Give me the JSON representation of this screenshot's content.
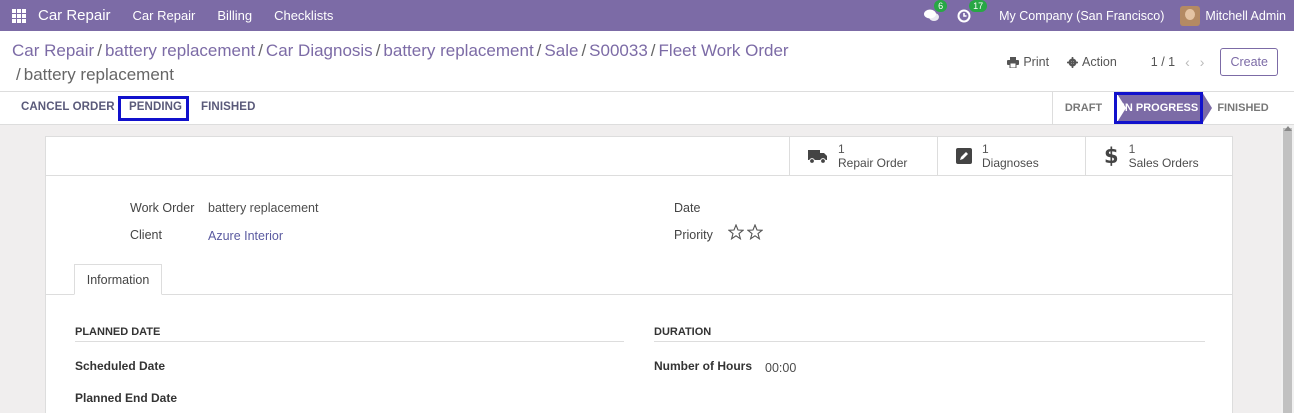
{
  "navbar": {
    "app_name": "Car Repair",
    "menus": [
      "Car Repair",
      "Billing",
      "Checklists"
    ],
    "messages_count": "6",
    "activities_count": "17",
    "company": "My Company (San Francisco)",
    "user": "Mitchell Admin"
  },
  "breadcrumb": {
    "items": [
      "Car Repair",
      "battery replacement",
      "Car Diagnosis",
      "battery replacement",
      "Sale",
      "S00033",
      "Fleet Work Order"
    ],
    "current": "battery replacement",
    "separator": "/"
  },
  "control": {
    "print_label": "Print",
    "action_label": "Action",
    "pager": "1 / 1",
    "create_label": "Create"
  },
  "statusbar": {
    "buttons": [
      "CANCEL ORDER",
      "PENDING",
      "FINISHED"
    ],
    "stages": [
      "DRAFT",
      "IN PROGRESS",
      "FINISHED"
    ],
    "active_stage": "IN PROGRESS",
    "highlight_color": "#1111cc"
  },
  "smart_buttons": [
    {
      "count": "1",
      "label": "Repair Order",
      "icon": "truck-icon"
    },
    {
      "count": "1",
      "label": "Diagnoses",
      "icon": "edit-icon"
    },
    {
      "count": "1",
      "label": "Sales Orders",
      "icon": "dollar-icon"
    }
  ],
  "form": {
    "work_order_label": "Work Order",
    "work_order_value": "battery replacement",
    "client_label": "Client",
    "client_value": "Azure Interior",
    "date_label": "Date",
    "priority_label": "Priority",
    "priority_stars": 0
  },
  "tabs": [
    "Information"
  ],
  "info": {
    "planned_title": "PLANNED DATE",
    "scheduled_label": "Scheduled Date",
    "planned_end_label": "Planned End Date",
    "duration_title": "DURATION",
    "hours_label": "Number of Hours",
    "hours_value": "00:00"
  },
  "colors": {
    "brand": "#7c6ba6",
    "badge": "#28a745"
  }
}
